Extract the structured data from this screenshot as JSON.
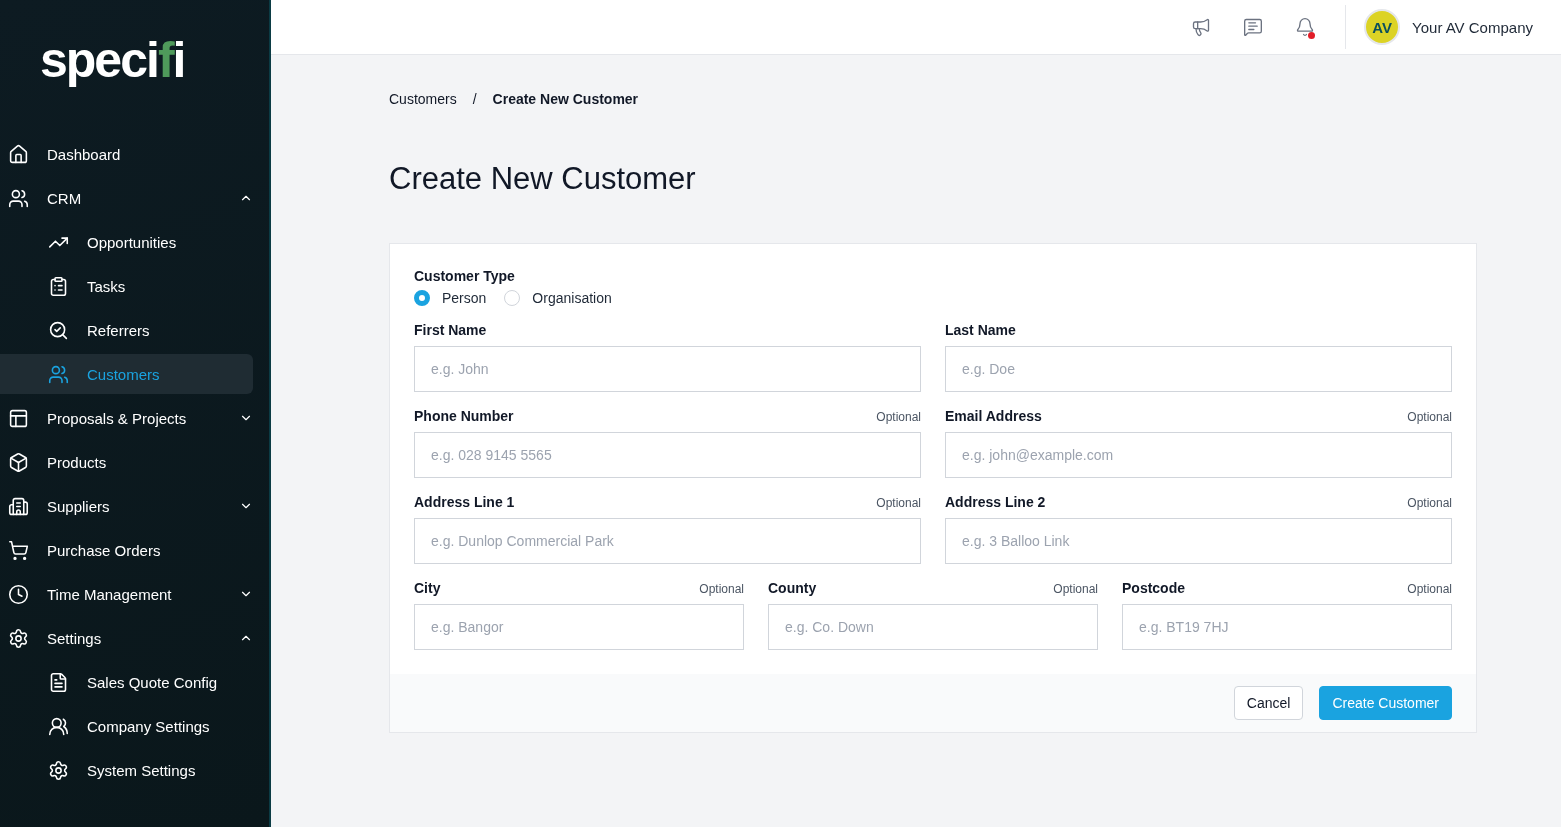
{
  "logo": [
    {
      "text": "spec",
      "color": "#ffffff"
    },
    {
      "text": "i",
      "color": "#ffffff"
    },
    {
      "text": "f",
      "color": "#4f9a5b"
    },
    {
      "text": "i",
      "color": "#ffffff"
    }
  ],
  "sidebar": {
    "items": [
      {
        "label": "Dashboard",
        "selected": false
      },
      {
        "label": "CRM",
        "selected": false,
        "expanded": true,
        "children": [
          {
            "label": "Opportunities",
            "selected": false
          },
          {
            "label": "Tasks",
            "selected": false
          },
          {
            "label": "Referrers",
            "selected": false
          },
          {
            "label": "Customers",
            "selected": true
          }
        ]
      },
      {
        "label": "Proposals & Projects",
        "selected": false,
        "expanded": false
      },
      {
        "label": "Products",
        "selected": false
      },
      {
        "label": "Suppliers",
        "selected": false,
        "expanded": false
      },
      {
        "label": "Purchase Orders",
        "selected": false
      },
      {
        "label": "Time Management",
        "selected": false,
        "expanded": false
      },
      {
        "label": "Settings",
        "selected": false,
        "expanded": true,
        "children": [
          {
            "label": "Sales Quote Config",
            "selected": false
          },
          {
            "label": "Company Settings",
            "selected": false
          },
          {
            "label": "System Settings",
            "selected": false
          }
        ]
      }
    ]
  },
  "topbar": {
    "notifications_unread": true,
    "avatar": "AV",
    "company": "Your AV Company"
  },
  "breadcrumb": [
    "Customers",
    "/",
    "Create New Customer"
  ],
  "title": "Create New Customer",
  "form": {
    "customer_type": {
      "label": "Customer Type",
      "options": [
        {
          "label": "Person",
          "selected": true
        },
        {
          "label": "Organisation",
          "selected": false
        }
      ]
    },
    "rows": [
      [
        {
          "label": "First Name",
          "placeholder": "e.g. John"
        },
        {
          "label": "Last Name",
          "placeholder": "e.g. Doe"
        }
      ],
      [
        {
          "label": "Phone Number",
          "optional": "Optional",
          "placeholder": "e.g. 028 9145 5565"
        },
        {
          "label": "Email Address",
          "optional": "Optional",
          "placeholder": "e.g. john@example.com"
        }
      ],
      [
        {
          "label": "Address Line 1",
          "optional": "Optional",
          "placeholder": "e.g. Dunlop Commercial Park"
        },
        {
          "label": "Address Line 2",
          "optional": "Optional",
          "placeholder": "e.g. 3 Balloo Link"
        }
      ],
      [
        {
          "label": "City",
          "optional": "Optional",
          "placeholder": "e.g. Bangor"
        },
        {
          "label": "County",
          "optional": "Optional",
          "placeholder": "e.g. Co. Down"
        },
        {
          "label": "Postcode",
          "optional": "Optional",
          "placeholder": "e.g. BT19 7HJ"
        }
      ]
    ],
    "buttons": [
      {
        "label": "Cancel",
        "kind": "secondary"
      },
      {
        "label": "Create Customer",
        "kind": "primary"
      }
    ]
  }
}
